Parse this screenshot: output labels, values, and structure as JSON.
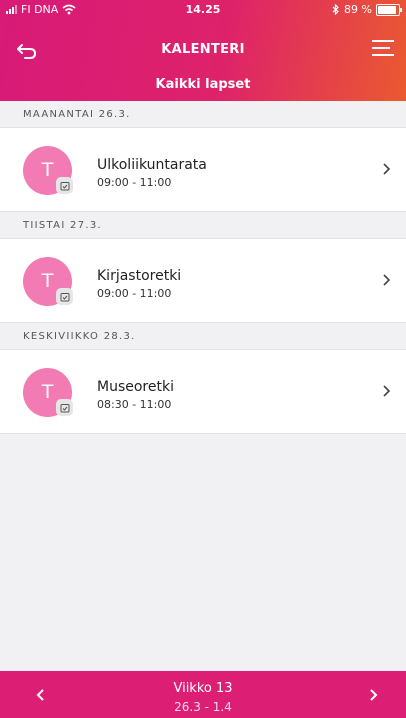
{
  "status_bar": {
    "carrier": "FI DNA",
    "time": "14.25",
    "battery_text": "89 %",
    "battery_level": 0.89
  },
  "header": {
    "title": "KALENTERI",
    "subtitle": "Kaikki lapset",
    "gradient_start": "#d81a78",
    "gradient_end": "#ea5a30"
  },
  "days": [
    {
      "label": "MAANANTAI 26.3.",
      "events": [
        {
          "avatar_initial": "T",
          "name": "Ulkoliikuntarata",
          "time": "09:00 - 11:00"
        }
      ]
    },
    {
      "label": "TIISTAI 27.3.",
      "events": [
        {
          "avatar_initial": "T",
          "name": "Kirjastoretki",
          "time": "09:00 - 11:00"
        }
      ]
    },
    {
      "label": "KESKIVIIKKO 28.3.",
      "events": [
        {
          "avatar_initial": "T",
          "name": "Museoretki",
          "time": "08:30 - 11:00"
        }
      ]
    }
  ],
  "footer": {
    "week_label": "Viikko 13",
    "week_range": "26.3 - 1.4",
    "color": "#dc1f74"
  },
  "icons": {
    "back": "back-arrow-icon",
    "menu": "menu-icon",
    "badge": "calendar-check-icon",
    "chevron": "chevron-right-icon"
  },
  "colors": {
    "avatar": "#f27bb4",
    "background": "#f1f1f4"
  }
}
